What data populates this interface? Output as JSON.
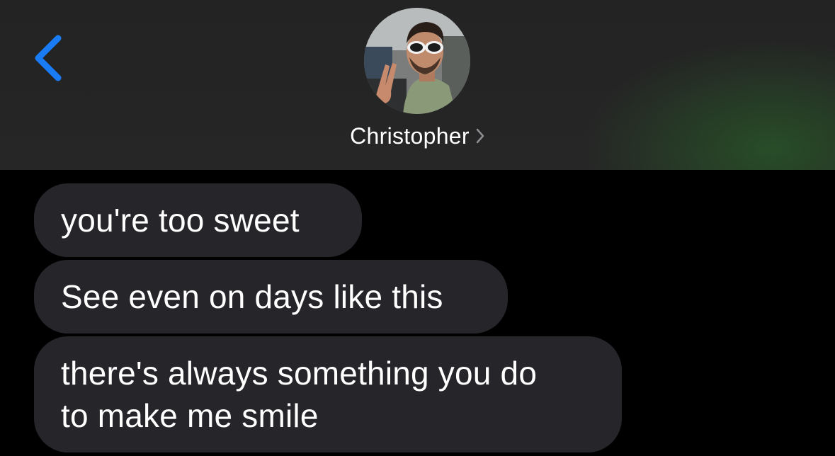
{
  "header": {
    "contact_name": "Christopher",
    "back_icon": "chevron-left-icon",
    "name_chevron_icon": "chevron-right-icon"
  },
  "colors": {
    "accent": "#1a7cf5",
    "bubble_incoming": "#26252a",
    "background": "#000000",
    "header_background": "#252525"
  },
  "messages": [
    {
      "text": "you're too sweet",
      "direction": "incoming"
    },
    {
      "text": "See even on days like this",
      "direction": "incoming"
    },
    {
      "text": "there's always something you do\nto make me smile",
      "direction": "incoming"
    }
  ]
}
